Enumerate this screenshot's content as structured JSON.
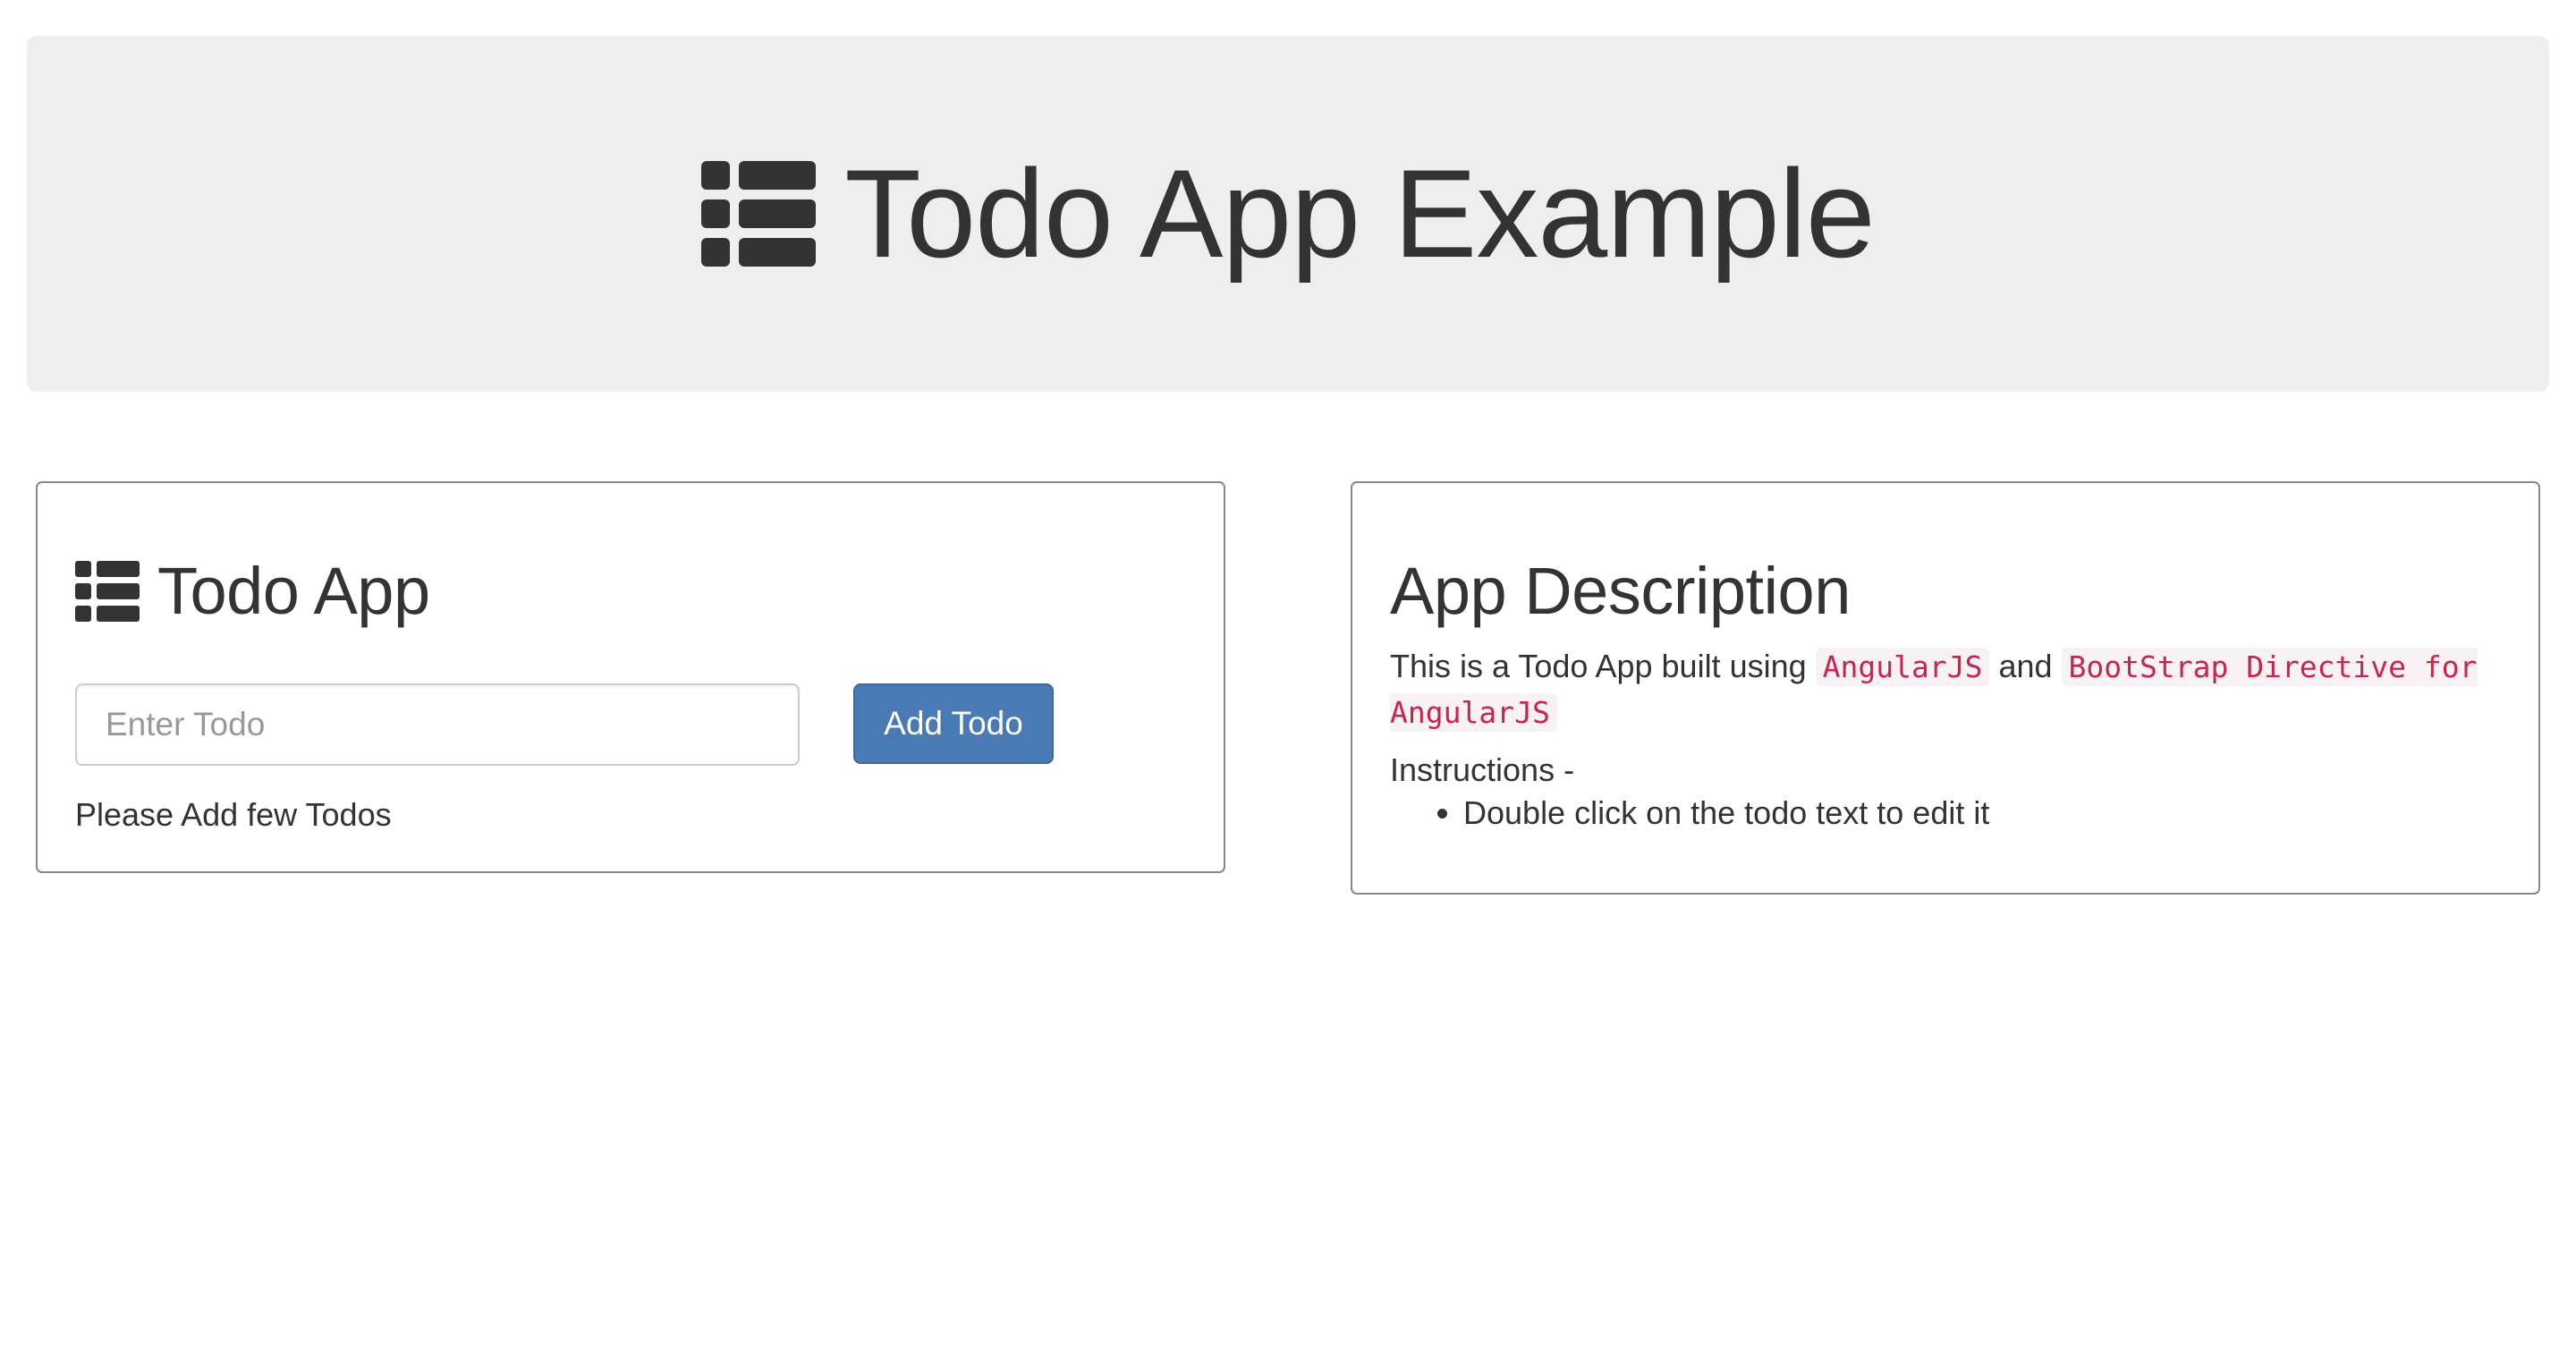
{
  "header": {
    "title": "Todo App Example",
    "icon": "list-icon",
    "background": "#eeeeee"
  },
  "todo_panel": {
    "heading": "Todo App",
    "icon": "list-icon",
    "input": {
      "placeholder": "Enter Todo",
      "value": ""
    },
    "add_button_label": "Add Todo",
    "add_button_color": "#4a7ab3",
    "empty_message": "Please Add few Todos"
  },
  "description_panel": {
    "heading": "App Description",
    "intro_prefix": "This is a Todo App built using ",
    "tech1": "AngularJS",
    "intro_middle": " and ",
    "tech2": "BootStrap Directive for AngularJS",
    "instructions_label": "Instructions -",
    "instructions": [
      "Double click on the todo text to edit it"
    ],
    "code_color": "#c7254e"
  }
}
